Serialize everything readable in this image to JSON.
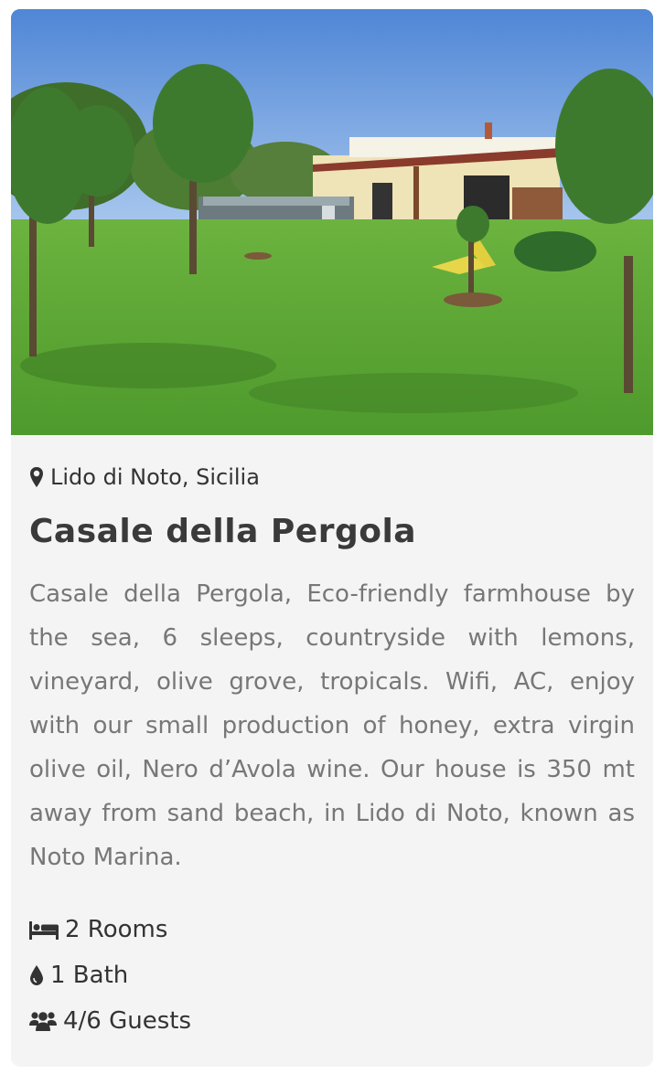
{
  "card": {
    "location": "Lido di Noto, Sicilia",
    "title": "Casale della Pergola",
    "description": "Casale della Pergola, Eco-friendly farmhouse by the sea, 6 sleeps, countryside with lemons, vineyard, olive grove, tropicals. Wifi, AC, enjoy with our small production of honey, extra virgin olive oil, Nero d’Avola wine. Our house is 350 mt away from sand beach, in Lido di Noto, known as Noto Marina.",
    "features": [
      {
        "icon": "bed-icon",
        "label": "2  Rooms"
      },
      {
        "icon": "water-drop-icon",
        "label": "1 Bath"
      },
      {
        "icon": "users-icon",
        "label": "4/6 Guests"
      }
    ]
  },
  "colors": {
    "card_background": "#f4f4f4",
    "title": "#3a3a3a",
    "description": "#777777",
    "text": "#333333"
  }
}
